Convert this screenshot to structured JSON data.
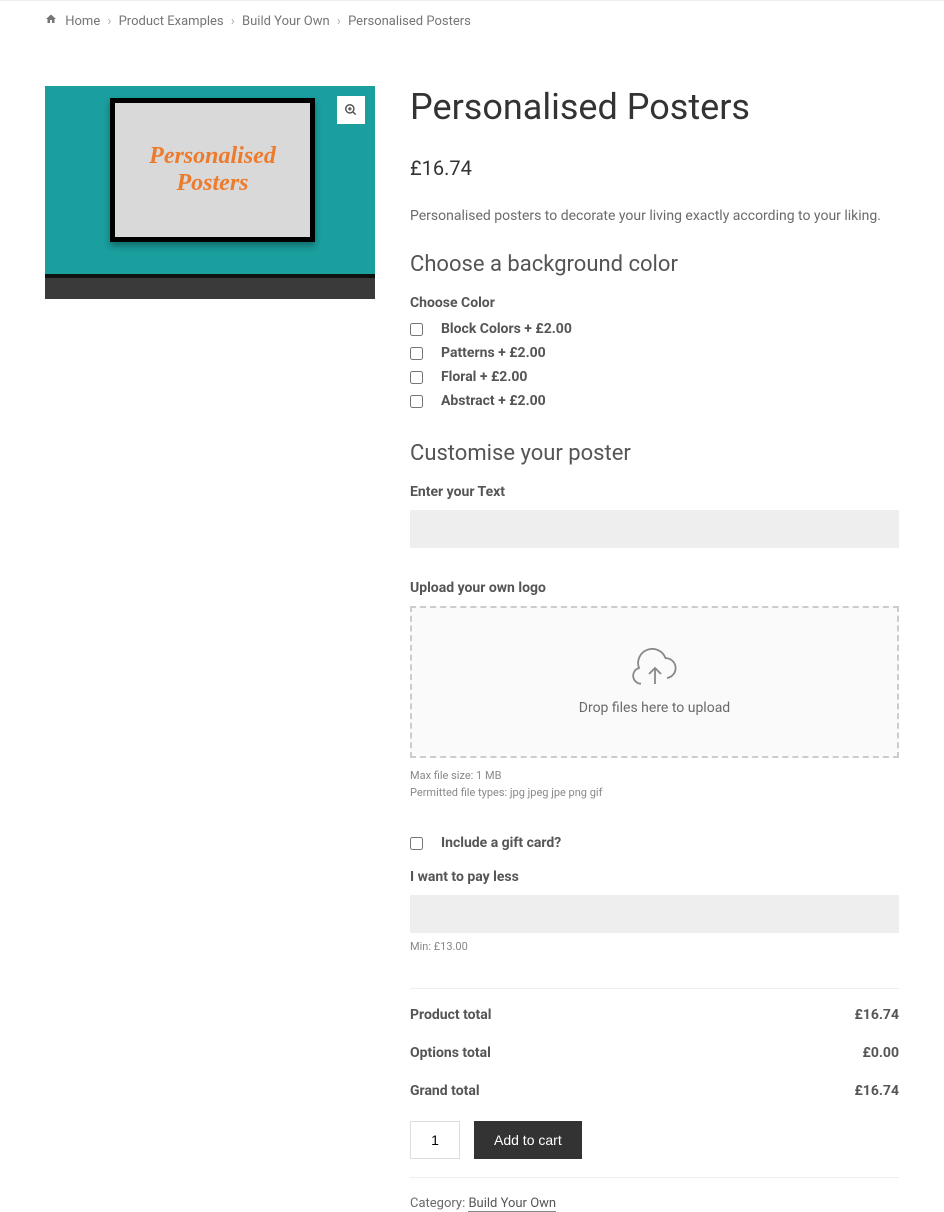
{
  "breadcrumb": {
    "home": "Home",
    "product_examples": "Product Examples",
    "build_your_own": "Build Your Own",
    "current": "Personalised Posters"
  },
  "product": {
    "title": "Personalised Posters",
    "price": "£16.74",
    "description": "Personalised posters to decorate your living exactly according to your liking.",
    "image_text": "Personalised Posters"
  },
  "bg_color_section": {
    "heading": "Choose a background color",
    "label": "Choose Color",
    "options": [
      "Block Colors + £2.00",
      "Patterns + £2.00",
      "Floral + £2.00",
      "Abstract + £2.00"
    ]
  },
  "customise_section": {
    "heading": "Customise your poster",
    "text_label": "Enter your Text",
    "upload_label": "Upload your own logo",
    "dropzone_text": "Drop files here to upload",
    "max_file": "Max file size: 1 MB",
    "file_types": "Permitted file types: jpg jpeg jpe png gif"
  },
  "gift_card": {
    "label": "Include a gift card?"
  },
  "pay_less": {
    "label": "I want to pay less",
    "hint": "Min: £13.00"
  },
  "totals": {
    "product_label": "Product total",
    "product_value": "£16.74",
    "options_label": "Options total",
    "options_value": "£0.00",
    "grand_label": "Grand total",
    "grand_value": "£16.74"
  },
  "cart": {
    "quantity": "1",
    "button": "Add to cart"
  },
  "category": {
    "label": "Category: ",
    "link": "Build Your Own"
  }
}
